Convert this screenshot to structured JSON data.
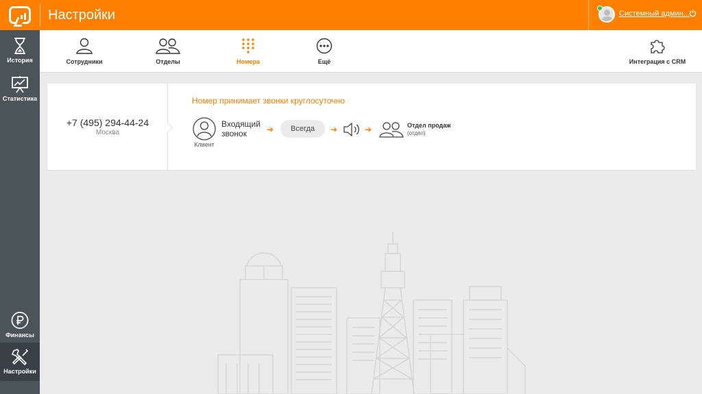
{
  "header": {
    "title": "Настройки",
    "user_name": "Системный админ...",
    "logo_icon": "phone-bubble-logo-icon",
    "power_icon": "power-icon",
    "accent_color": "#ff7f00"
  },
  "sidebar": {
    "background": "#4b5459",
    "items": [
      {
        "label": "История",
        "icon": "hourglass-icon"
      },
      {
        "label": "Статистика",
        "icon": "chart-board-icon"
      },
      {
        "label": "Финансы",
        "icon": "ruble-coin-icon"
      },
      {
        "label": "Настройки",
        "icon": "tools-icon",
        "active": true
      }
    ]
  },
  "tabs": [
    {
      "label": "Сотрудники",
      "icon": "user-icon"
    },
    {
      "label": "Отделы",
      "icon": "users-icon"
    },
    {
      "label": "Номера",
      "icon": "dialpad-icon",
      "active": true
    },
    {
      "label": "Ещё",
      "icon": "more-icon"
    },
    {
      "label": "Интеграция с CRM",
      "icon": "puzzle-icon"
    }
  ],
  "number_card": {
    "phone": "+7 (495) 294-44-24",
    "city": "Москва",
    "schedule": "Номер принимает звонки круглосуточно",
    "flow": {
      "client_label": "Клиент",
      "incoming": "Входящий звонок",
      "condition": "Всегда",
      "dept_name": "Отдел продаж",
      "dept_type": "(отдел)"
    }
  }
}
